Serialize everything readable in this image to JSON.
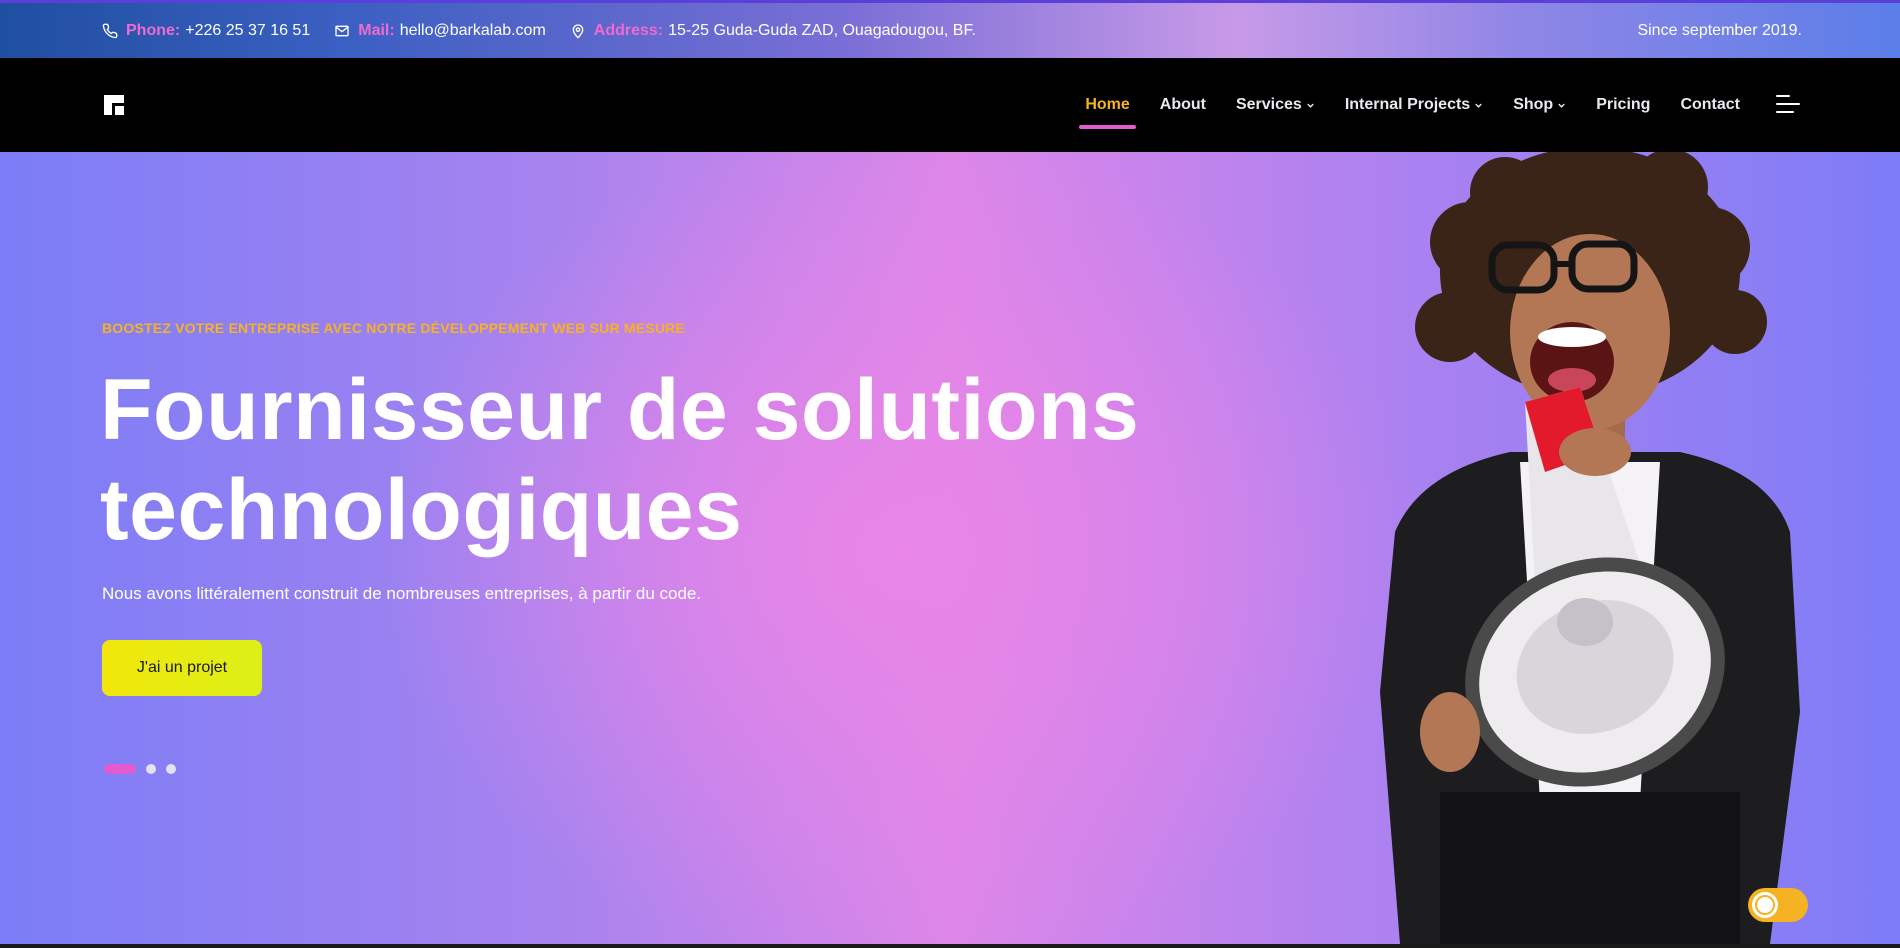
{
  "topbar": {
    "phone_label": "Phone:",
    "phone_value": "+226 25 37 16 51",
    "mail_label": "Mail:",
    "mail_value": "hello@barkalab.com",
    "address_label": "Address:",
    "address_value": "15-25 Guda-Guda ZAD, Ouagadougou, BF.",
    "since": "Since september 2019."
  },
  "nav": {
    "items": [
      {
        "label": "Home",
        "active": true,
        "dropdown": false
      },
      {
        "label": "About",
        "active": false,
        "dropdown": false
      },
      {
        "label": "Services",
        "active": false,
        "dropdown": true
      },
      {
        "label": "Internal Projects",
        "active": false,
        "dropdown": true
      },
      {
        "label": "Shop",
        "active": false,
        "dropdown": true
      },
      {
        "label": "Pricing",
        "active": false,
        "dropdown": false
      },
      {
        "label": "Contact",
        "active": false,
        "dropdown": false
      }
    ]
  },
  "hero": {
    "eyebrow": "BOOSTEZ VOTRE ENTREPRISE AVEC NOTRE DÉVELOPPEMENT WEB SUR MESURE",
    "title_line1": "Fournisseur de solutions",
    "title_line2": "technologiques",
    "subtitle": "Nous avons littéralement construit de nombreuses entreprises, à partir du code.",
    "cta": "J'ai un projet",
    "slides": 3,
    "active_slide": 1
  },
  "colors": {
    "accent_pink": "#e35bd0",
    "accent_orange": "#f5b324",
    "cta_yellow": "#f2e60a",
    "nav_bg": "#000000"
  },
  "icons": [
    "phone-icon",
    "mail-icon",
    "location-pin-icon",
    "logo-icon",
    "chevron-down-icon",
    "hamburger-menu-icon",
    "dark-mode-icon"
  ]
}
